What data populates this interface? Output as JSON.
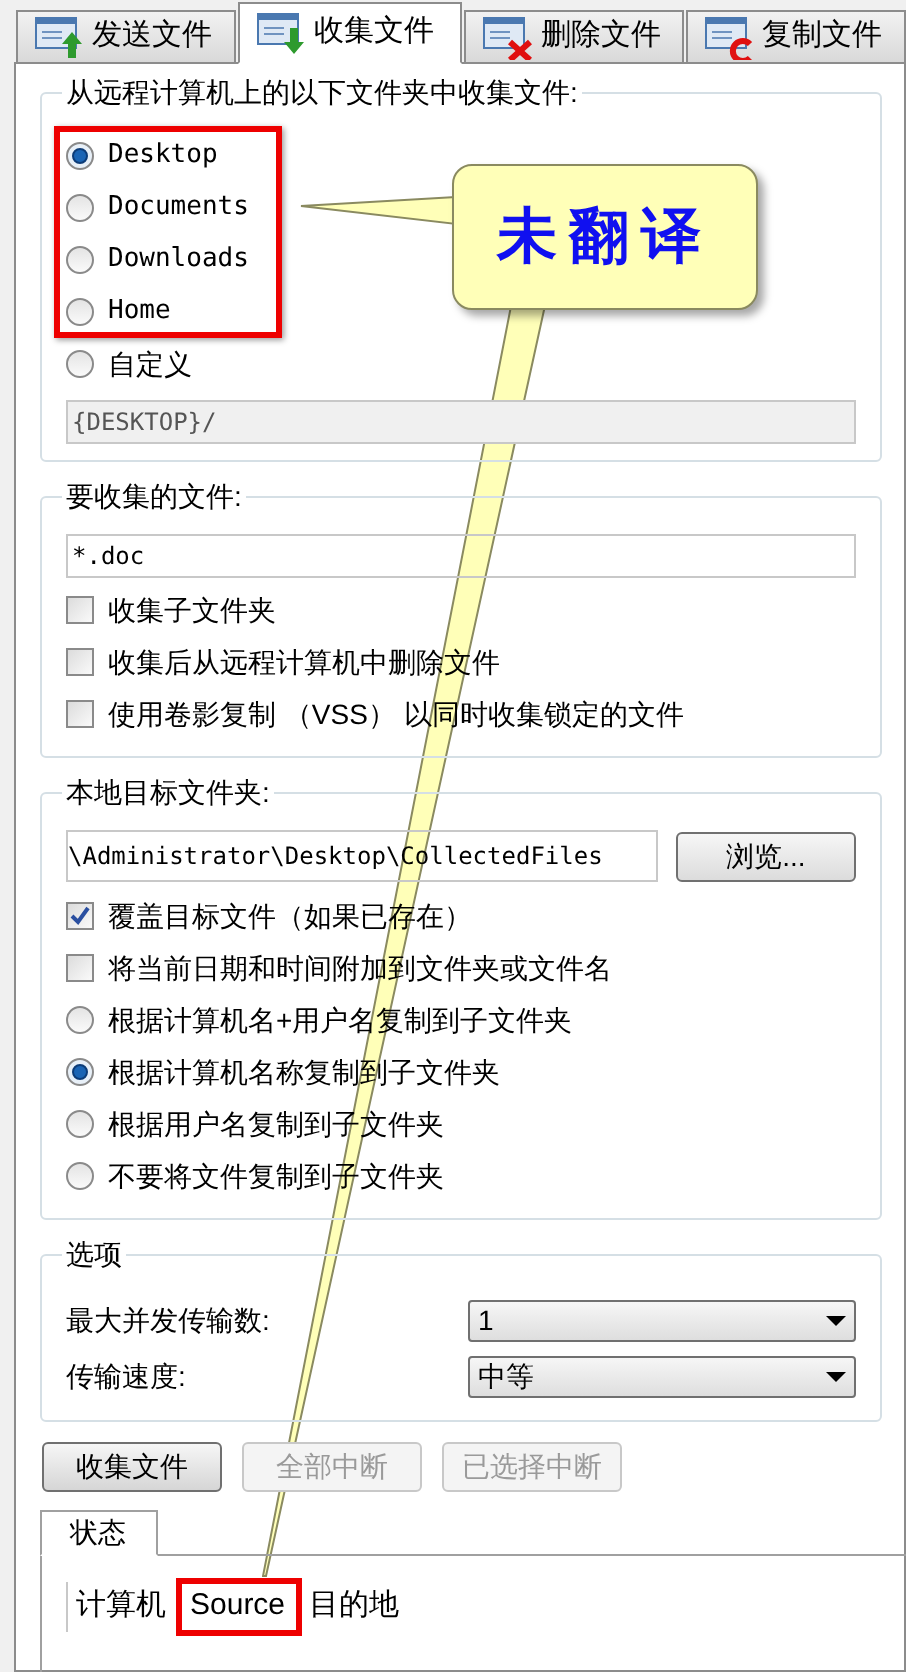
{
  "tabs": [
    {
      "label": "发送文件",
      "selected": false
    },
    {
      "label": "收集文件",
      "selected": true
    },
    {
      "label": "删除文件",
      "selected": false
    },
    {
      "label": "复制文件",
      "selected": false
    }
  ],
  "source_group": {
    "title": "从远程计算机上的以下文件夹中收集文件:",
    "options": [
      {
        "label": "Desktop",
        "selected": true
      },
      {
        "label": "Documents",
        "selected": false
      },
      {
        "label": "Downloads",
        "selected": false
      },
      {
        "label": "Home",
        "selected": false
      },
      {
        "label": "自定义",
        "selected": false
      }
    ],
    "custom_path": {
      "value": "{DESKTOP}/",
      "disabled": true
    }
  },
  "files_group": {
    "title": "要收集的文件:",
    "pattern": "*.doc",
    "checkboxes": [
      {
        "label": "收集子文件夹",
        "checked": false
      },
      {
        "label": "收集后从远程计算机中删除文件",
        "checked": false
      },
      {
        "label": "使用卷影复制 （VSS） 以同时收集锁定的文件",
        "checked": false
      }
    ]
  },
  "target_group": {
    "title": "本地目标文件夹:",
    "path": "\\Administrator\\Desktop\\CollectedFiles",
    "browse": "浏览...",
    "options": [
      {
        "kind": "checkbox",
        "label": "覆盖目标文件（如果已存在）",
        "checked": true
      },
      {
        "kind": "checkbox",
        "label": "将当前日期和时间附加到文件夹或文件名",
        "checked": false
      },
      {
        "kind": "radio",
        "label": "根据计算机名+用户名复制到子文件夹",
        "selected": false
      },
      {
        "kind": "radio",
        "label": "根据计算机名称复制到子文件夹",
        "selected": true
      },
      {
        "kind": "radio",
        "label": "根据用户名复制到子文件夹",
        "selected": false
      },
      {
        "kind": "radio",
        "label": "不要将文件复制到子文件夹",
        "selected": false
      }
    ]
  },
  "options_group": {
    "title": "选项",
    "rows": [
      {
        "label": "最大并发传输数:",
        "value": "1"
      },
      {
        "label": "传输速度:",
        "value": "中等"
      }
    ]
  },
  "buttons": [
    {
      "label": "收集文件",
      "disabled": false
    },
    {
      "label": "全部中断",
      "disabled": true
    },
    {
      "label": "已选择中断",
      "disabled": true
    }
  ],
  "status_tab": {
    "label": "状态",
    "columns": [
      "计算机",
      "Source",
      "目的地"
    ]
  },
  "callout": {
    "text": "未翻译"
  }
}
